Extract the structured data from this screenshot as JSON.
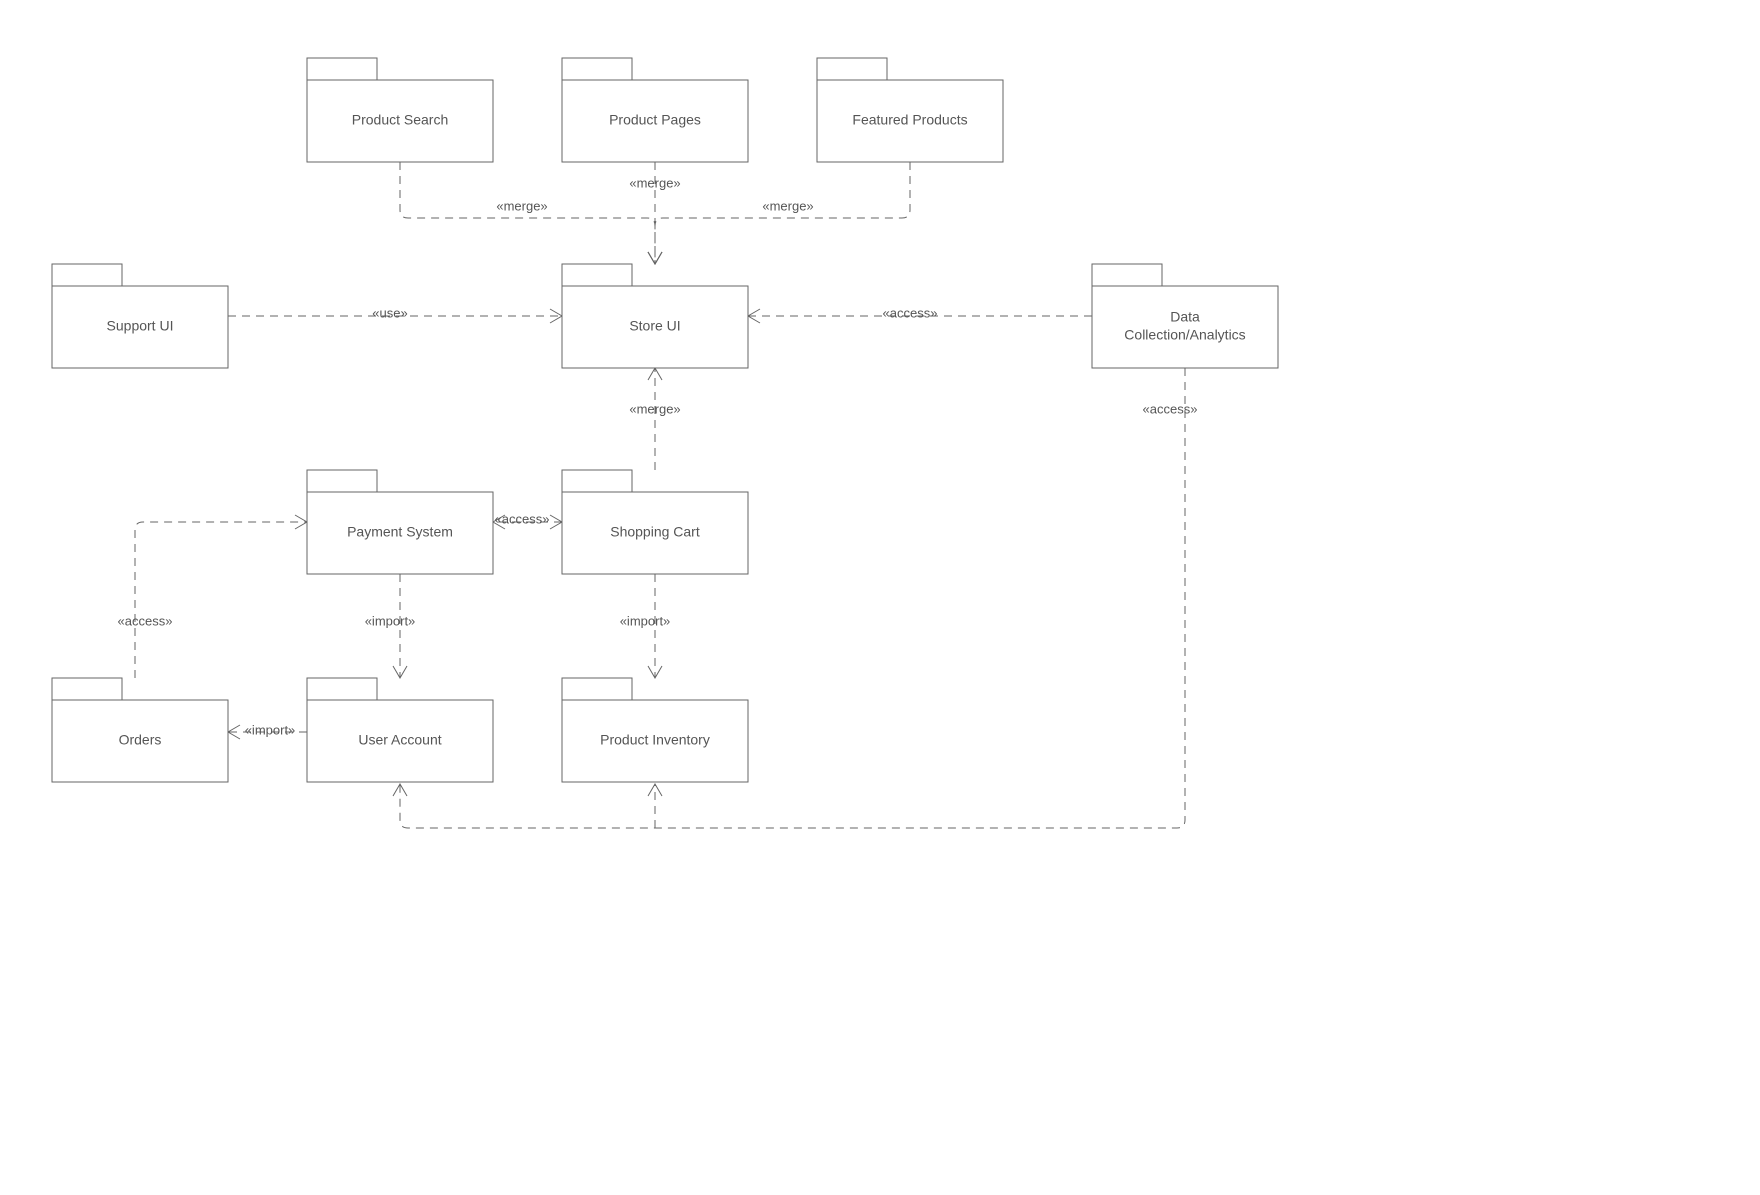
{
  "packages": {
    "productSearch": {
      "label": "Product Search"
    },
    "productPages": {
      "label": "Product Pages"
    },
    "featuredProducts": {
      "label": "Featured Products"
    },
    "supportUI": {
      "label": "Support UI"
    },
    "storeUI": {
      "label": "Store UI"
    },
    "dataAnalytics1": {
      "label": "Data"
    },
    "dataAnalytics2": {
      "label": "Collection/Analytics"
    },
    "paymentSystem": {
      "label": "Payment System"
    },
    "shoppingCart": {
      "label": "Shopping Cart"
    },
    "orders": {
      "label": "Orders"
    },
    "userAccount": {
      "label": "User Account"
    },
    "productInventory": {
      "label": "Product Inventory"
    }
  },
  "stereotypes": {
    "merge": "«merge»",
    "use": "«use»",
    "access": "«access»",
    "import": "«import»"
  }
}
